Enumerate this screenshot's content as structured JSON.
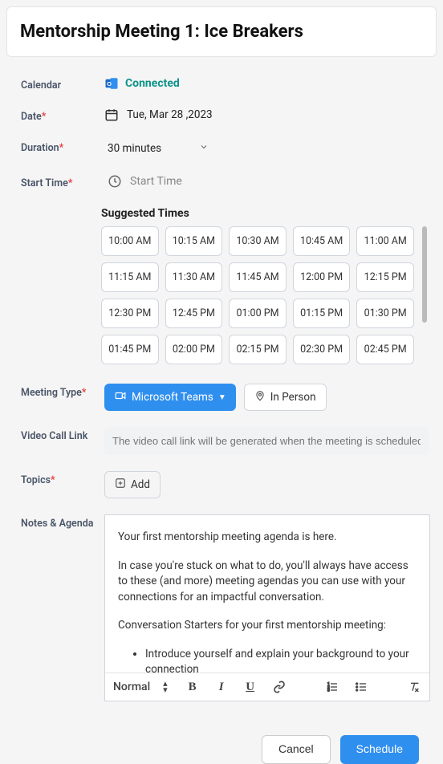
{
  "title": "Mentorship Meeting 1: Ice Breakers",
  "labels": {
    "calendar": "Calendar",
    "date": "Date",
    "duration": "Duration",
    "start_time": "Start Time",
    "meeting_type": "Meeting Type",
    "video_link": "Video Call Link",
    "topics": "Topics",
    "notes": "Notes & Agenda"
  },
  "calendar": {
    "status": "Connected"
  },
  "date": {
    "value": "Tue, Mar 28 ,2023"
  },
  "duration": {
    "value": "30 minutes"
  },
  "start_time": {
    "placeholder": "Start Time"
  },
  "suggested": {
    "label": "Suggested Times",
    "times": [
      "10:00 AM",
      "10:15 AM",
      "10:30 AM",
      "10:45 AM",
      "11:00 AM",
      "11:15 AM",
      "11:30 AM",
      "11:45 AM",
      "12:00 PM",
      "12:15 PM",
      "12:30 PM",
      "12:45 PM",
      "01:00 PM",
      "01:15 PM",
      "01:30 PM",
      "01:45 PM",
      "02:00 PM",
      "02:15 PM",
      "02:30 PM",
      "02:45 PM"
    ]
  },
  "meeting_type": {
    "teams": "Microsoft Teams",
    "in_person": "In Person"
  },
  "video_link": {
    "placeholder": "The video call link will be generated when the meeting is scheduled."
  },
  "topics": {
    "add": "Add"
  },
  "notes": {
    "p1": "Your first mentorship meeting agenda is here.",
    "p2": "In case you're stuck on what to do, you'll always have access to these (and more) meeting agendas you can use with your connections for an impactful conversation.",
    "p3": "Conversation Starters for your first mentorship meeting:",
    "li1": "Introduce yourself and explain your background to your connection"
  },
  "toolbar": {
    "format": "Normal"
  },
  "footer": {
    "cancel": "Cancel",
    "schedule": "Schedule"
  }
}
